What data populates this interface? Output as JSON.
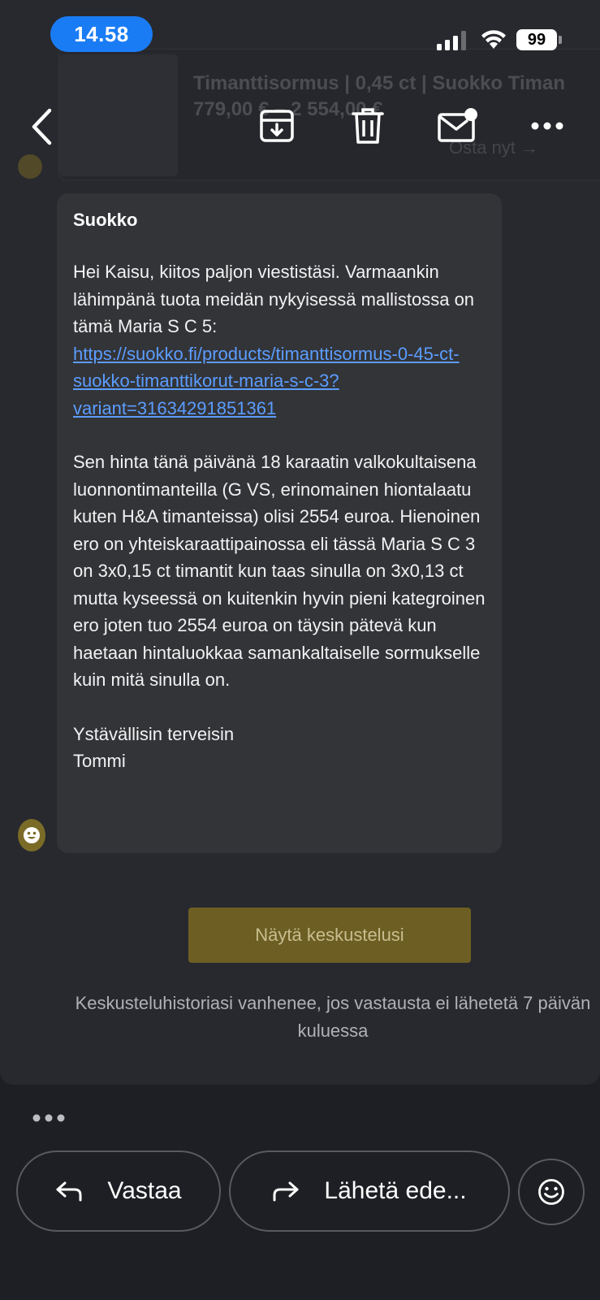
{
  "status_bar": {
    "time": "14.58",
    "battery": "99"
  },
  "background_card": {
    "title": "Timanttisormus | 0,45 ct | Suokko Timan",
    "price": "779,00 € – 2 554,00 €",
    "sub": "Osta nyt →"
  },
  "toolbar": {
    "icons": [
      "back-icon",
      "archive-icon",
      "trash-icon",
      "mark-unread-icon",
      "more-icon"
    ]
  },
  "message": {
    "sender": "Suokko",
    "para1_text": "Hei Kaisu, kiitos paljon viestistäsi. Varmaankin lähimpänä tuota meidän nykyisessä mallistossa on tämä Maria S C 5: ",
    "para1_link": "https://suokko.fi/products/timanttisormus-0-45-ct-suokko-timanttikorut-maria-s-c-3?variant=31634291851361",
    "para2": "Sen hinta tänä päivänä 18 karaatin valkokultaisena luonnontimanteilla (G VS, erinomainen hiontalaatu kuten H&A timanteissa) olisi 2554 euroa. Hienoinen ero on yhteiskaraattipainossa eli tässä Maria S C 3 on 3x0,15 ct timantit kun taas sinulla on 3x0,13 ct mutta kyseessä on kuitenkin hyvin pieni kategroinen ero joten tuo 2554 euroa on täysin pätevä kun haetaan hintaluokkaa samankaltaiselle sormukselle kuin mitä sinulla on.",
    "signoff": "Ystävällisin terveisin",
    "signature": "Tommi"
  },
  "cta": {
    "label": "Näytä keskustelusi"
  },
  "expiry_notice": "Keskusteluhistoriasi vanhenee, jos vastausta ei lähetetä 7 päivän kuluessa",
  "actions": {
    "reply_label": "Vastaa",
    "forward_label": "Lähetä ede..."
  },
  "colors": {
    "accent_blue": "#1a7cf5",
    "link": "#5b9dff",
    "cta_gold": "#6d5f23"
  }
}
